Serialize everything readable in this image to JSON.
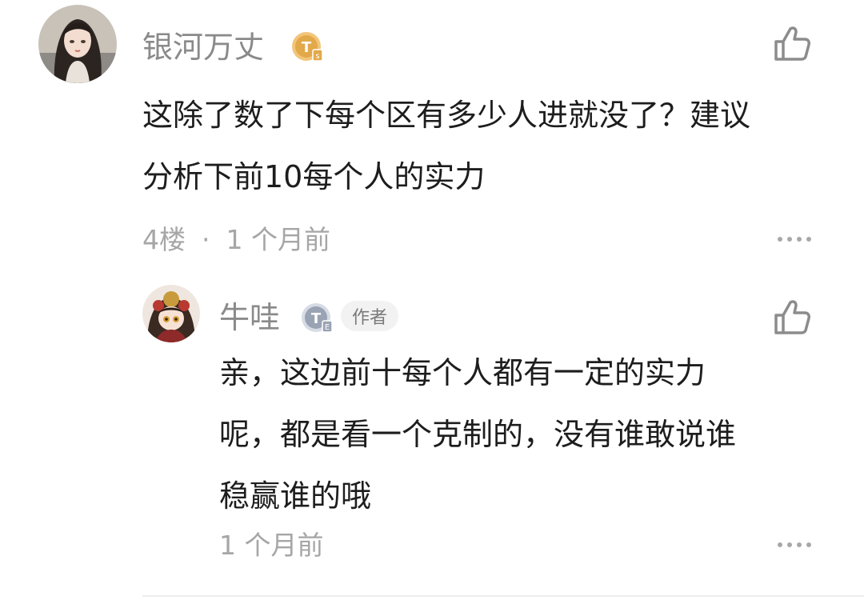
{
  "comment": {
    "username": "银河万丈",
    "level_badge": "TS",
    "text_lines": [
      "这除了数了下每个区有多少人进就没了？建议",
      "分析下前10每个人的实力"
    ],
    "floor": "4楼",
    "separator": "·",
    "time": "1 个月前",
    "like_icon": "thumbs-up-icon",
    "more_icon": "more-dots-icon"
  },
  "reply": {
    "username": "牛哇",
    "level_badge": "TE",
    "author_tag": "作者",
    "text_lines": [
      "亲，这边前十每个人都有一定的实力",
      "呢，都是看一个克制的，没有谁敢说谁",
      "稳赢谁的哦"
    ],
    "time": "1 个月前",
    "like_icon": "thumbs-up-icon",
    "more_icon": "more-dots-icon"
  },
  "colors": {
    "gold_badge": "#e2a94a",
    "silver_badge": "#9aa3b3"
  }
}
